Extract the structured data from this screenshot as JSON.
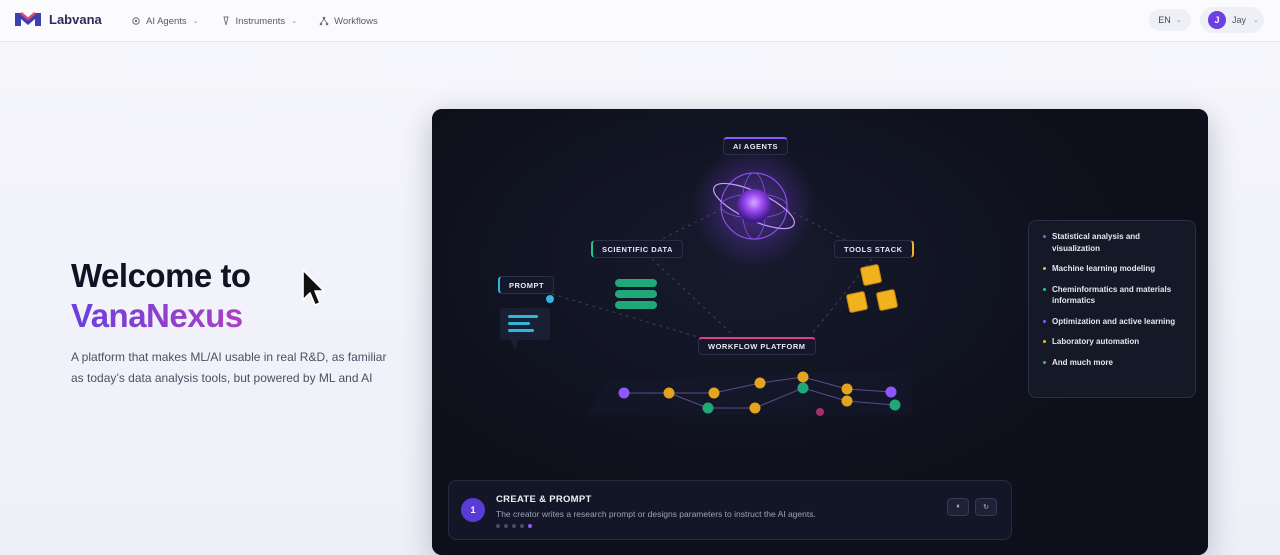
{
  "brand": {
    "name": "Labvana",
    "logo_icon": "labvana-logo-icon"
  },
  "nav": {
    "items": [
      {
        "label": "AI Agents",
        "icon": "gear-icon",
        "has_dropdown": true
      },
      {
        "label": "Instruments",
        "icon": "pipette-icon",
        "has_dropdown": true
      },
      {
        "label": "Workflows",
        "icon": "workflow-icon",
        "has_dropdown": false
      }
    ]
  },
  "language": {
    "value": "EN"
  },
  "user": {
    "initial": "J",
    "name": "Jay"
  },
  "hero": {
    "title_line1": "Welcome to",
    "title_line2": "VanaNexus",
    "description": "A platform that makes ML/AI usable in real R&D, as familiar as today’s data analysis tools, but powered by ML and AI"
  },
  "diagram": {
    "tags": {
      "ai_agents": "AI AGENTS",
      "scientific_data": "SCIENTIFIC DATA",
      "tools_stack": "TOOLS STACK",
      "prompt": "PROMPT",
      "workflow_platform": "WORKFLOW PLATFORM"
    },
    "features": [
      {
        "label": "Statistical analysis and visualization",
        "color": "#8e57ff"
      },
      {
        "label": "Machine learning modeling",
        "color": "#f3b62a"
      },
      {
        "label": "Cheminformatics and materials informatics",
        "color": "#23c48d"
      },
      {
        "label": "Optimization and active learning",
        "color": "#8e57ff"
      },
      {
        "label": "Laboratory automation",
        "color": "#f3b62a"
      },
      {
        "label": "And much more",
        "color": "#23c48d"
      }
    ]
  },
  "step": {
    "number": "1",
    "title": "CREATE & PROMPT",
    "description": "The creator writes a research prompt or designs parameters to instruct the AI agents.",
    "pause_symbol": "⏸",
    "restart_symbol": "↻"
  },
  "colors": {
    "accent": "#6b3fe0",
    "panel_bg": "#0d0f1a"
  }
}
